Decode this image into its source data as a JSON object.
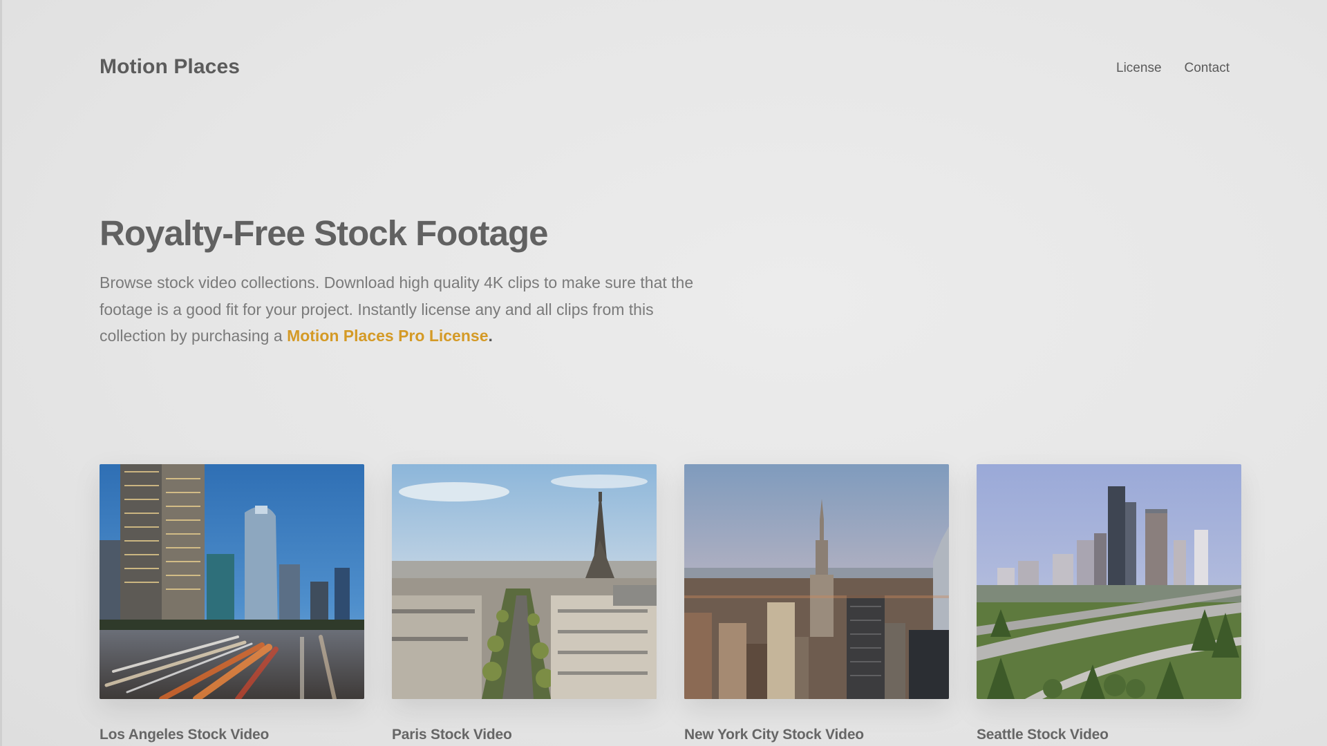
{
  "header": {
    "brand": "Motion Places",
    "nav": [
      {
        "label": "License"
      },
      {
        "label": "Contact"
      }
    ]
  },
  "hero": {
    "title": "Royalty-Free Stock Footage",
    "description_before_link": "Browse stock video collections. Download high quality 4K clips to make sure that the footage is a good fit for your project. Instantly license any and all clips from this collection by purchasing a ",
    "link_text": "Motion Places Pro License",
    "description_after_link": "."
  },
  "collections": [
    {
      "title": "Los Angeles Stock Video",
      "icon": "los-angeles-skyline-photo"
    },
    {
      "title": "Paris Stock Video",
      "icon": "paris-eiffel-tower-photo"
    },
    {
      "title": "New York City Stock Video",
      "icon": "new-york-skyline-photo"
    },
    {
      "title": "Seattle Stock Video",
      "icon": "seattle-skyline-photo"
    }
  ],
  "colors": {
    "accent": "#d49a26",
    "background": "#e8e8e8",
    "text": "#5f5f5f"
  }
}
